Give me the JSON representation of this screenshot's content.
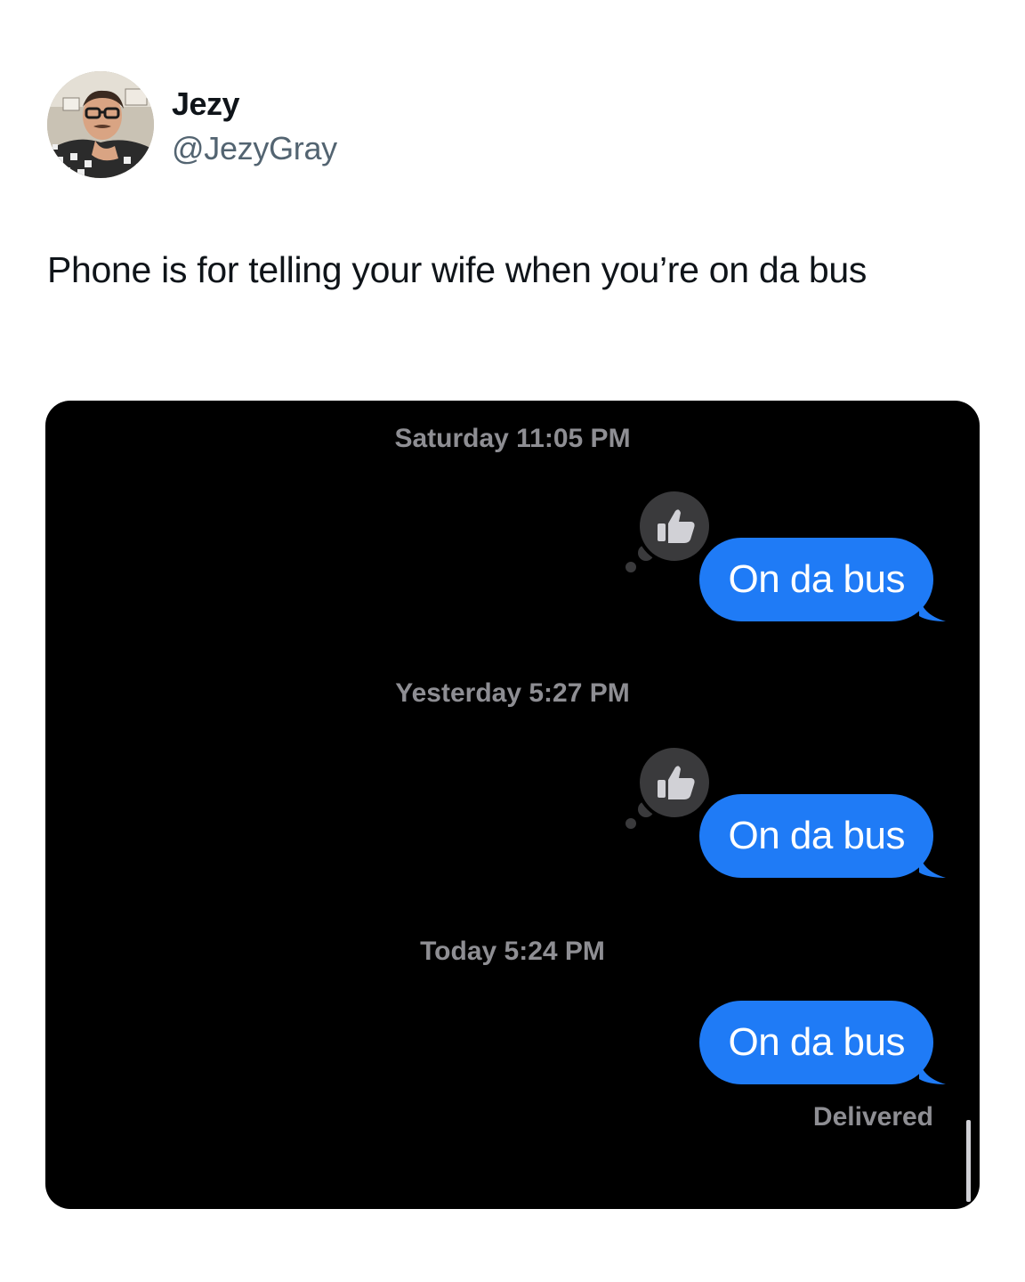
{
  "tweet": {
    "author": {
      "display_name": "Jezy",
      "handle": "@JezyGray"
    },
    "text": "Phone is for telling your wife when you’re on da bus"
  },
  "conversation": {
    "groups": [
      {
        "timestamp": "Saturday 11:05 PM",
        "message": "On da bus",
        "tapback": "thumbs-up"
      },
      {
        "timestamp": "Yesterday 5:27 PM",
        "message": "On da bus",
        "tapback": "thumbs-up"
      },
      {
        "timestamp": "Today 5:24 PM",
        "message": "On da bus",
        "tapback": null
      }
    ],
    "status": "Delivered"
  },
  "colors": {
    "bubble": "#1f7bf6",
    "media_background": "#000000",
    "timestamp_text": "#8e8e93",
    "handle_text": "#536471",
    "tapback_background": "#3a3a3c"
  }
}
